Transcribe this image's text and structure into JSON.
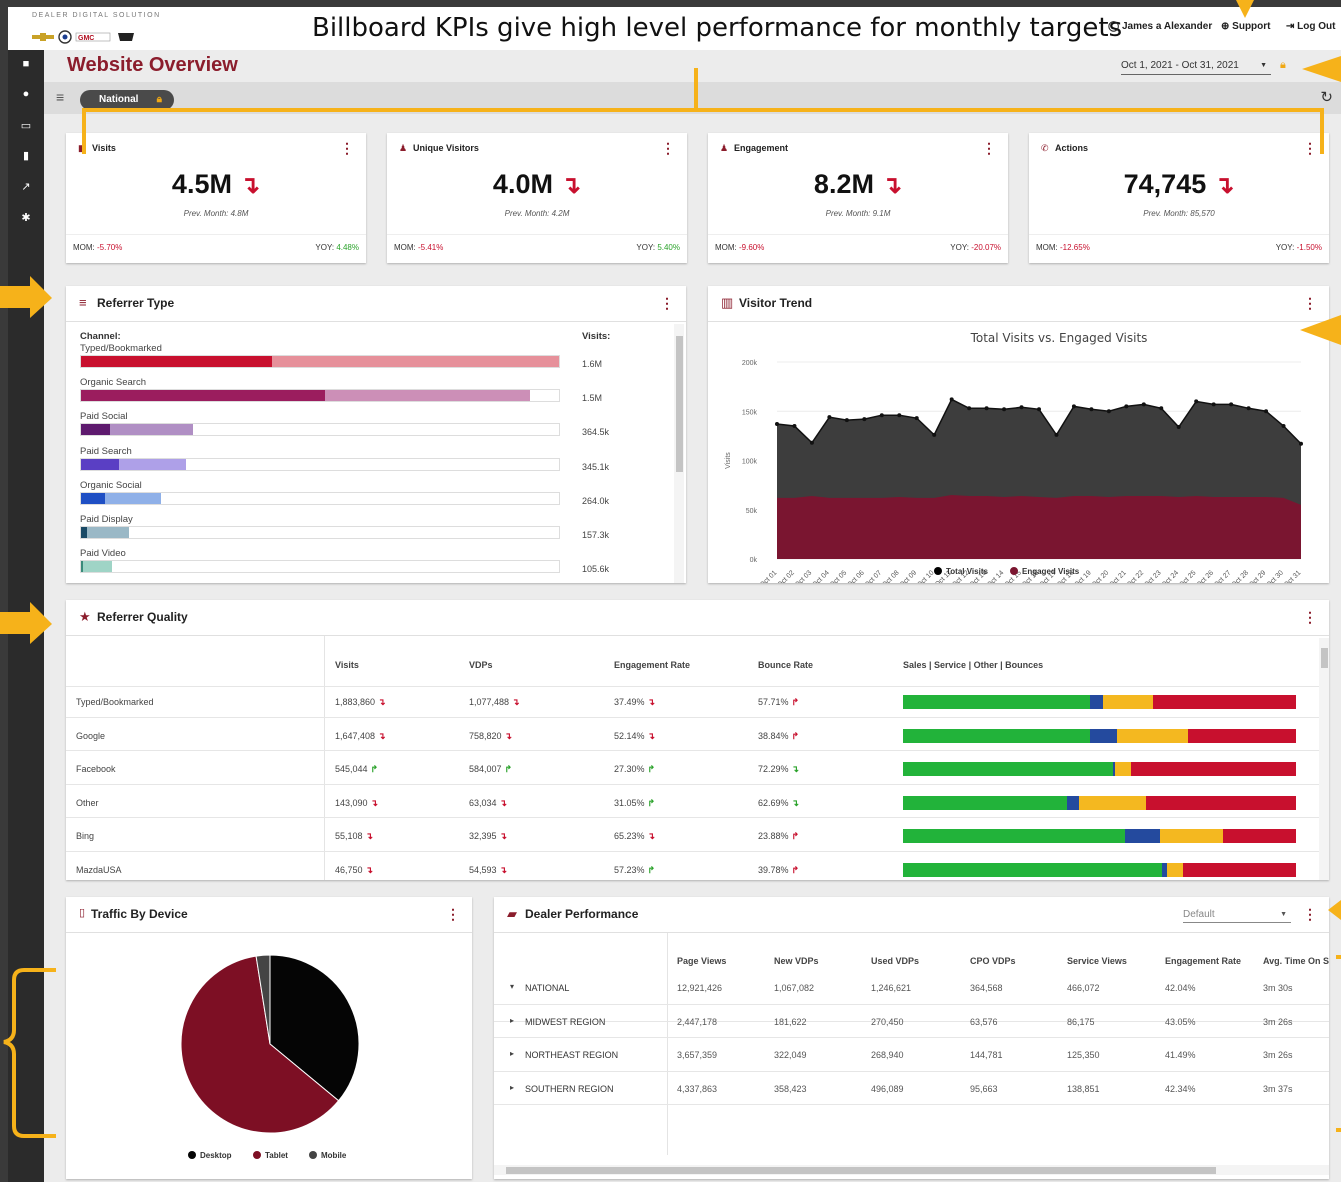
{
  "header": {
    "brand_small": "DEALER DIGITAL SOLUTION",
    "caption": "Billboard KPIs give high level performance for monthly targets",
    "user_name": "James a Alexander",
    "support_label": "Support",
    "logout_label": "Log Out"
  },
  "page": {
    "title": "Website Overview",
    "date_range": "Oct 1, 2021 - Oct 31, 2021",
    "filter_chip": "National"
  },
  "kpis": [
    {
      "title": "Visits",
      "value": "4.5M",
      "prev": "Prev. Month: 4.8M",
      "mom_label": "MOM:",
      "mom": "-5.70%",
      "yoy_label": "YOY:",
      "yoy": "4.48%",
      "icon": "chart-icon"
    },
    {
      "title": "Unique Visitors",
      "value": "4.0M",
      "prev": "Prev. Month: 4.2M",
      "mom_label": "MOM:",
      "mom": "-5.41%",
      "yoy_label": "YOY:",
      "yoy": "5.40%",
      "icon": "user-icon"
    },
    {
      "title": "Engagement",
      "value": "8.2M",
      "prev": "Prev. Month: 9.1M",
      "mom_label": "MOM:",
      "mom": "-9.60%",
      "yoy_label": "YOY:",
      "yoy": "-20.07%",
      "icon": "user-plus-icon"
    },
    {
      "title": "Actions",
      "value": "74,745",
      "prev": "Prev. Month: 85,570",
      "mom_label": "MOM:",
      "mom": "-12.65%",
      "yoy_label": "YOY:",
      "yoy": "-1.50%",
      "icon": "phone-icon"
    }
  ],
  "referrer_type": {
    "title": "Referrer Type",
    "channel_header": "Channel:",
    "visits_header": "Visits:",
    "rows": [
      {
        "label": "Typed/Bookmarked",
        "value": "1.6M",
        "dark": 0.4,
        "total": 1.0,
        "c1": "#c8102e",
        "c2": "#e6909a"
      },
      {
        "label": "Organic Search",
        "value": "1.5M",
        "dark": 0.51,
        "total": 0.94,
        "c1": "#9b1d5e",
        "c2": "#cc8fb7"
      },
      {
        "label": "Paid Social",
        "value": "364.5k",
        "dark": 0.06,
        "total": 0.234,
        "c1": "#5e1a6e",
        "c2": "#b08fc4"
      },
      {
        "label": "Paid Search",
        "value": "345.1k",
        "dark": 0.08,
        "total": 0.22,
        "c1": "#5a3fc4",
        "c2": "#aea0e8"
      },
      {
        "label": "Organic Social",
        "value": "264.0k",
        "dark": 0.05,
        "total": 0.168,
        "c1": "#1f4fc4",
        "c2": "#8fb0e8"
      },
      {
        "label": "Paid Display",
        "value": "157.3k",
        "dark": 0.012,
        "total": 0.1,
        "c1": "#1a4a66",
        "c2": "#9ab8c6"
      },
      {
        "label": "Paid Video",
        "value": "105.6k",
        "dark": 0.004,
        "total": 0.065,
        "c1": "#3a8a7a",
        "c2": "#9fd4c6"
      }
    ]
  },
  "visitor_trend": {
    "title": "Visitor Trend",
    "chart_data": {
      "type": "area",
      "title": "Total Visits vs. Engaged Visits",
      "ylabel": "Visits",
      "ylim": [
        0,
        200000
      ],
      "yticks": [
        "0k",
        "50k",
        "100k",
        "150k",
        "200k"
      ],
      "categories": [
        "Oct 01",
        "Oct 02",
        "Oct 03",
        "Oct 04",
        "Oct 05",
        "Oct 06",
        "Oct 07",
        "Oct 08",
        "Oct 09",
        "Oct 10",
        "Oct 11",
        "Oct 12",
        "Oct 13",
        "Oct 14",
        "Oct 15",
        "Oct 16",
        "Oct 17",
        "Oct 18",
        "Oct 19",
        "Oct 20",
        "Oct 21",
        "Oct 22",
        "Oct 23",
        "Oct 24",
        "Oct 25",
        "Oct 26",
        "Oct 27",
        "Oct 28",
        "Oct 29",
        "Oct 30",
        "Oct 31"
      ],
      "series": [
        {
          "name": "Total Visits",
          "color": "#3d3d3d",
          "values": [
            137000,
            135000,
            118000,
            144000,
            141000,
            142000,
            146000,
            146000,
            143000,
            126000,
            162000,
            153000,
            153000,
            152000,
            154000,
            152000,
            126000,
            155000,
            152000,
            150000,
            155000,
            157000,
            153000,
            134000,
            160000,
            157000,
            157000,
            153000,
            150000,
            135000,
            117000
          ]
        },
        {
          "name": "Engaged Visits",
          "color": "#7a1530",
          "values": [
            62000,
            62000,
            64000,
            62000,
            62000,
            62000,
            62000,
            63000,
            62000,
            62000,
            65000,
            64000,
            64000,
            63000,
            64000,
            63000,
            62000,
            64000,
            64000,
            63000,
            64000,
            64000,
            64000,
            63000,
            64000,
            63000,
            63000,
            63000,
            63000,
            62000,
            55000
          ]
        }
      ]
    }
  },
  "referrer_quality": {
    "title": "Referrer Quality",
    "headers": [
      "Visits",
      "VDPs",
      "Engagement Rate",
      "Bounce Rate",
      "Sales | Service | Other | Bounces"
    ],
    "stack_colors": [
      "#22b33a",
      "#244a9e",
      "#f4b820",
      "#c8102e"
    ],
    "rows": [
      {
        "name": "Typed/Bookmarked",
        "visits": "1,883,860",
        "v_dir": "down",
        "vdps": "1,077,488",
        "vd_dir": "down",
        "eng": "37.49%",
        "e_dir": "down",
        "bounce": "57.71%",
        "b_dir": "up",
        "stack": [
          0.475,
          0.035,
          0.125,
          0.365
        ]
      },
      {
        "name": "Google",
        "visits": "1,647,408",
        "v_dir": "down",
        "vdps": "758,820",
        "vd_dir": "down",
        "eng": "52.14%",
        "e_dir": "down",
        "bounce": "38.84%",
        "b_dir": "up",
        "stack": [
          0.475,
          0.07,
          0.18,
          0.275
        ]
      },
      {
        "name": "Facebook",
        "visits": "545,044",
        "v_dir": "up",
        "vdps": "584,007",
        "vd_dir": "up",
        "eng": "27.30%",
        "e_dir": "up",
        "bounce": "72.29%",
        "b_dir": "down",
        "stack": [
          0.535,
          0.005,
          0.04,
          0.42
        ]
      },
      {
        "name": "Other",
        "visits": "143,090",
        "v_dir": "down",
        "vdps": "63,034",
        "vd_dir": "down",
        "eng": "31.05%",
        "e_dir": "up",
        "bounce": "62.69%",
        "b_dir": "down",
        "stack": [
          0.418,
          0.03,
          0.17,
          0.382
        ]
      },
      {
        "name": "Bing",
        "visits": "55,108",
        "v_dir": "down",
        "vdps": "32,395",
        "vd_dir": "down",
        "eng": "65.23%",
        "e_dir": "down",
        "bounce": "23.88%",
        "b_dir": "up",
        "stack": [
          0.565,
          0.088,
          0.162,
          0.185
        ]
      },
      {
        "name": "MazdaUSA",
        "visits": "46,750",
        "v_dir": "down",
        "vdps": "54,593",
        "vd_dir": "down",
        "eng": "57.23%",
        "e_dir": "up",
        "bounce": "39.78%",
        "b_dir": "up",
        "stack": [
          0.66,
          0.012,
          0.04,
          0.288
        ]
      }
    ]
  },
  "traffic_by_device": {
    "title": "Traffic By Device",
    "chart_data": {
      "type": "pie",
      "slices": [
        {
          "name": "Desktop",
          "value": 36,
          "color": "#050505"
        },
        {
          "name": "Tablet",
          "value": 61.5,
          "color": "#7d0f24"
        },
        {
          "name": "Mobile",
          "value": 2.5,
          "color": "#444444"
        }
      ]
    }
  },
  "dealer_performance": {
    "title": "Dealer Performance",
    "select_value": "Default",
    "headers": [
      "Page Views",
      "New VDPs",
      "Used VDPs",
      "CPO VDPs",
      "Service Views",
      "Engagement Rate",
      "Avg. Time On S"
    ],
    "rows": [
      {
        "name": "NATIONAL",
        "expander": "▾",
        "cells": [
          "12,921,426",
          "1,067,082",
          "1,246,621",
          "364,568",
          "466,072",
          "42.04%",
          "3m 30s"
        ]
      },
      {
        "name": "MIDWEST REGION",
        "expander": "▸",
        "cells": [
          "2,447,178",
          "181,622",
          "270,450",
          "63,576",
          "86,175",
          "43.05%",
          "3m 26s"
        ]
      },
      {
        "name": "NORTHEAST REGION",
        "expander": "▸",
        "cells": [
          "3,657,359",
          "322,049",
          "268,940",
          "144,781",
          "125,350",
          "41.49%",
          "3m 26s"
        ]
      },
      {
        "name": "SOUTHERN REGION",
        "expander": "▸",
        "cells": [
          "4,337,863",
          "358,423",
          "496,089",
          "95,663",
          "138,851",
          "42.34%",
          "3m 37s"
        ]
      }
    ]
  }
}
